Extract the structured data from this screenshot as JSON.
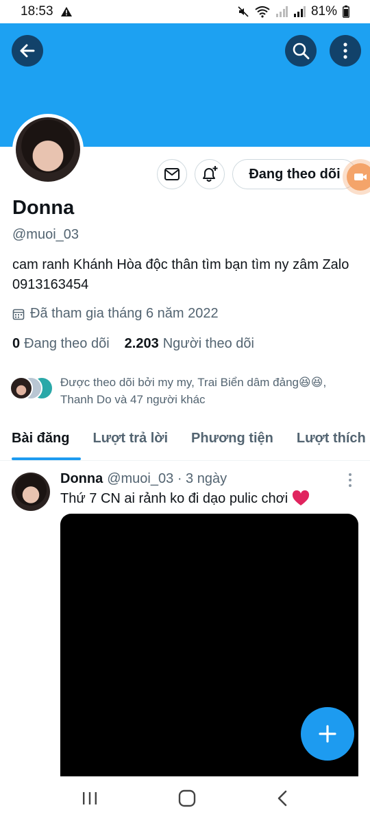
{
  "status_bar": {
    "time": "18:53",
    "battery": "81%"
  },
  "profile": {
    "name": "Donna",
    "handle": "@muoi_03",
    "bio": "cam ranh Khánh Hòa độc thân tìm bạn tìm ny zâm Zalo 0913163454",
    "joined": "Đã tham gia tháng 6 năm 2022",
    "following_count": "0",
    "following_label": "Đang theo dõi",
    "followers_count": "2.203",
    "followers_label": "Người theo dõi",
    "followed_by": "Được theo dõi bởi my my, Trai Biển dâm đảng😆😆, Thanh Do và 47 người khác",
    "follow_button_label": "Đang theo dõi"
  },
  "tabs": [
    {
      "label": "Bài đăng",
      "active": true
    },
    {
      "label": "Lượt trả lời",
      "active": false
    },
    {
      "label": "Phương tiện",
      "active": false
    },
    {
      "label": "Lượt thích",
      "active": false
    }
  ],
  "post": {
    "author": "Donna",
    "handle": "@muoi_03",
    "time": "· 3 ngày",
    "text": "Thứ 7 CN ai rảnh ko đi dạo pulic chơi",
    "emoji": "❤️"
  },
  "colors": {
    "banner": "#1da1f2",
    "accent": "#1d9bf0",
    "heart": "#e0245e"
  },
  "icons": [
    "back-arrow-icon",
    "search-icon",
    "more-vert-icon",
    "mail-icon",
    "bell-plus-icon",
    "calendar-icon",
    "plus-icon",
    "recents-icon",
    "home-icon",
    "nav-back-icon"
  ]
}
